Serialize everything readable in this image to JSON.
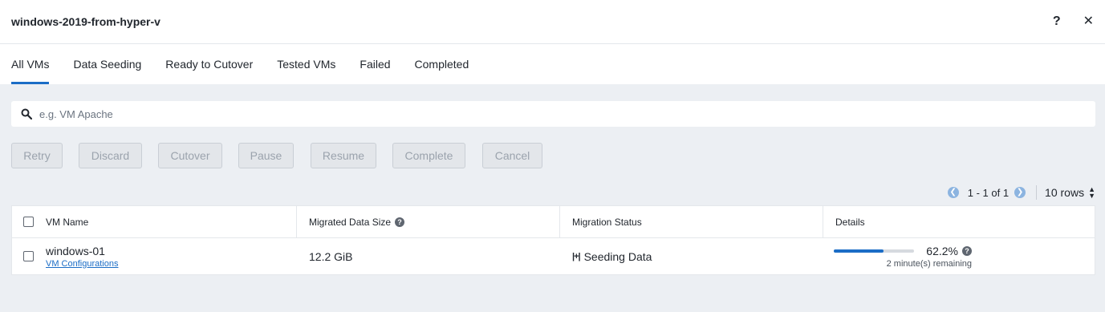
{
  "header": {
    "title": "windows-2019-from-hyper-v",
    "help_label": "?",
    "close_label": "✕"
  },
  "tabs": [
    {
      "label": "All VMs",
      "active": true
    },
    {
      "label": "Data Seeding"
    },
    {
      "label": "Ready to Cutover"
    },
    {
      "label": "Tested VMs"
    },
    {
      "label": "Failed"
    },
    {
      "label": "Completed"
    }
  ],
  "search": {
    "placeholder": "e.g. VM Apache",
    "value": ""
  },
  "actions": [
    "Retry",
    "Discard",
    "Cutover",
    "Pause",
    "Resume",
    "Complete",
    "Cancel"
  ],
  "pagination": {
    "range": "1 - 1 of 1",
    "rows": "10 rows"
  },
  "table": {
    "headers": {
      "vm_name": "VM Name",
      "migrated": "Migrated Data Size",
      "status": "Migration Status",
      "details": "Details"
    },
    "rows": [
      {
        "vm_name": "windows-01",
        "link": "VM Configurations",
        "migrated": "12.2 GiB",
        "status": "Seeding Data",
        "progress_percent": 62.2,
        "progress_label": "62.2%",
        "remaining": "2 minute(s) remaining"
      }
    ]
  },
  "colors": {
    "accent": "#1b6dc6",
    "background": "#eceff3"
  }
}
